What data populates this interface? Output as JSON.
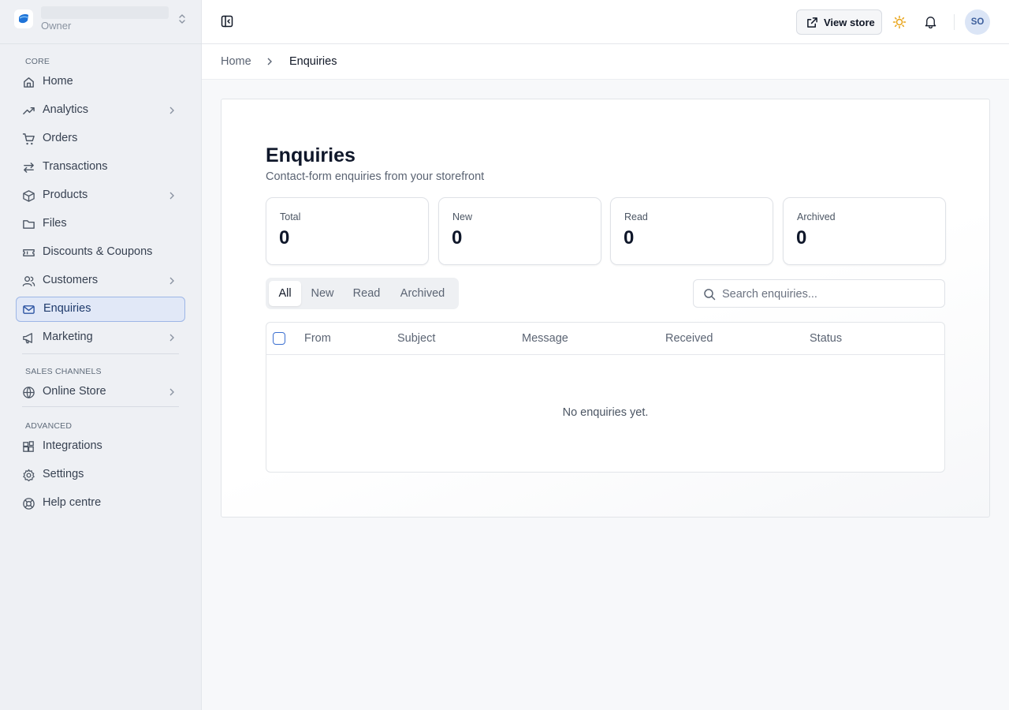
{
  "store": {
    "role": "Owner"
  },
  "sidebar": {
    "sections": {
      "core": "CORE",
      "sales_channels": "SALES CHANNELS",
      "advanced": "ADVANCED"
    },
    "items": [
      {
        "label": "Home",
        "icon": "home-icon"
      },
      {
        "label": "Analytics",
        "icon": "trending-up-icon",
        "has_submenu": true
      },
      {
        "label": "Orders",
        "icon": "cart-icon"
      },
      {
        "label": "Transactions",
        "icon": "arrows-swap-icon"
      },
      {
        "label": "Products",
        "icon": "box-icon",
        "has_submenu": true
      },
      {
        "label": "Files",
        "icon": "folder-icon"
      },
      {
        "label": "Discounts & Coupons",
        "icon": "ticket-icon"
      },
      {
        "label": "Customers",
        "icon": "users-icon",
        "has_submenu": true
      },
      {
        "label": "Enquiries",
        "icon": "mail-icon",
        "active": true
      },
      {
        "label": "Marketing",
        "icon": "megaphone-icon",
        "has_submenu": true
      },
      {
        "label": "Online Store",
        "icon": "globe-icon",
        "has_submenu": true
      },
      {
        "label": "Integrations",
        "icon": "blocks-icon"
      },
      {
        "label": "Settings",
        "icon": "gear-icon"
      },
      {
        "label": "Help centre",
        "icon": "lifebuoy-icon"
      }
    ]
  },
  "topbar": {
    "view_store_label": "View store",
    "avatar_initials": "SO"
  },
  "breadcrumb": {
    "home": "Home",
    "current": "Enquiries"
  },
  "page": {
    "title": "Enquiries",
    "subtitle": "Contact-form enquiries from your storefront"
  },
  "stats": [
    {
      "label": "Total",
      "value": "0"
    },
    {
      "label": "New",
      "value": "0"
    },
    {
      "label": "Read",
      "value": "0"
    },
    {
      "label": "Archived",
      "value": "0"
    }
  ],
  "tabs": [
    {
      "label": "All",
      "active": true
    },
    {
      "label": "New"
    },
    {
      "label": "Read"
    },
    {
      "label": "Archived"
    }
  ],
  "search": {
    "placeholder": "Search enquiries..."
  },
  "table": {
    "columns": [
      "From",
      "Subject",
      "Message",
      "Received",
      "Status"
    ],
    "empty_message": "No enquiries yet."
  },
  "colors": {
    "accent": "#3b6fd1",
    "active_nav_bg": "#e1e8f7",
    "sun": "#e8a317"
  }
}
